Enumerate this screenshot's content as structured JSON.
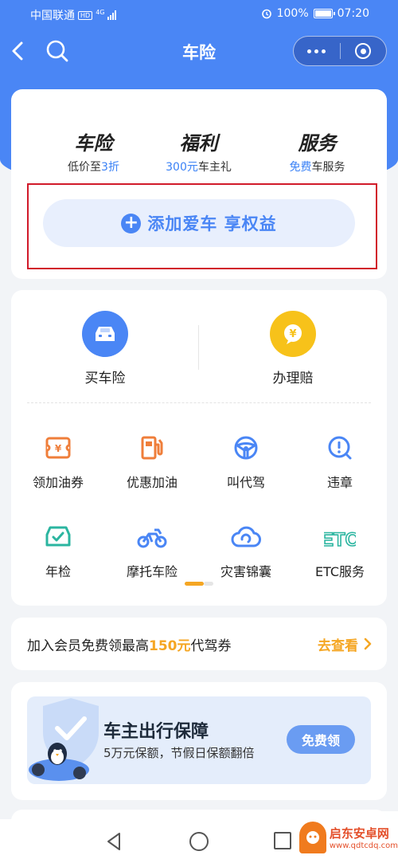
{
  "status_bar": {
    "carrier": "中国联通",
    "network_badge": "HD",
    "network_type": "4G",
    "battery": "100%",
    "time": "07:20"
  },
  "navbar": {
    "title": "车险",
    "back_icon": "chevron-left-icon",
    "search_icon": "search-icon",
    "more_icon": "more-dots-icon",
    "close_icon": "target-close-icon"
  },
  "features": [
    {
      "title": "车险",
      "sub_pre": "低价至",
      "sub_hl": "3折",
      "sub_post": ""
    },
    {
      "title": "福利",
      "sub_pre": "",
      "sub_hl": "300元",
      "sub_post": "车主礼"
    },
    {
      "title": "服务",
      "sub_pre": "",
      "sub_hl": "免费",
      "sub_post": "车服务"
    }
  ],
  "add_car": {
    "label": "添加爱车 享权益"
  },
  "primary_services": [
    {
      "label": "买车险",
      "icon": "car-icon",
      "color": "#4a86f5"
    },
    {
      "label": "办理赔",
      "icon": "yuan-chat-icon",
      "color": "#f7c21a"
    }
  ],
  "services": [
    {
      "label": "领加油券",
      "icon": "fuel-coupon-icon",
      "color": "#ef7e3a"
    },
    {
      "label": "优惠加油",
      "icon": "gas-pump-icon",
      "color": "#ef7e3a"
    },
    {
      "label": "叫代驾",
      "icon": "steering-wheel-icon",
      "color": "#4a86f5"
    },
    {
      "label": "违章",
      "icon": "violation-search-icon",
      "color": "#4a86f5"
    },
    {
      "label": "年检",
      "icon": "car-check-icon",
      "color": "#2bb5a0"
    },
    {
      "label": "摩托车险",
      "icon": "motorcycle-icon",
      "color": "#4a86f5"
    },
    {
      "label": "灾害锦囊",
      "icon": "cloud-swirl-icon",
      "color": "#4a86f5"
    },
    {
      "label": "ETC服务",
      "icon": "etc-icon",
      "color": "#2bb5a0"
    }
  ],
  "promo": {
    "text_pre": "加入会员免费领最高",
    "text_hl": "150元",
    "text_post": "代驾券",
    "link": "去查看"
  },
  "banner": {
    "title": "车主出行保障",
    "subtitle": "5万元保额，节假日保额翻倍",
    "button": "免费领"
  },
  "watermark": {
    "name": "启东安卓网",
    "url": "www.qdtcdq.com"
  },
  "colors": {
    "primary": "#4a86f5",
    "accent": "#f5a623",
    "highlight_border": "#d11a2a"
  }
}
